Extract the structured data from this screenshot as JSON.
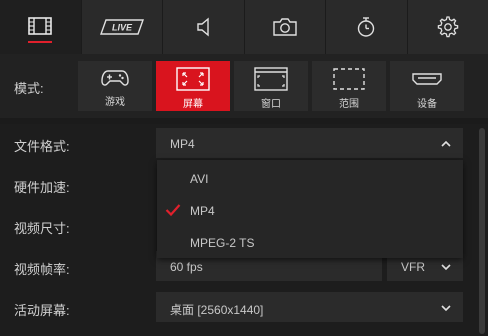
{
  "tabs": [
    {
      "icon": "film-icon",
      "active": true
    },
    {
      "icon": "live-icon",
      "text": "LIVE"
    },
    {
      "icon": "speaker-icon"
    },
    {
      "icon": "camera-icon"
    },
    {
      "icon": "stopwatch-icon"
    },
    {
      "icon": "gear-icon"
    }
  ],
  "mode": {
    "label": "模式:",
    "buttons": [
      {
        "label": "游戏",
        "icon": "gamepad-icon"
      },
      {
        "label": "屏幕",
        "icon": "fullscreen-icon",
        "active": true
      },
      {
        "label": "窗口",
        "icon": "window-icon"
      },
      {
        "label": "范围",
        "icon": "region-icon"
      },
      {
        "label": "设备",
        "icon": "hdmi-icon"
      }
    ]
  },
  "settings": {
    "file_format": {
      "label": "文件格式:",
      "value": "MP4"
    },
    "hw_accel": {
      "label": "硬件加速:"
    },
    "video_size": {
      "label": "视频尺寸:"
    },
    "frame_rate": {
      "label": "视频帧率:",
      "value": "60 fps",
      "mode_value": "VFR"
    },
    "active_screen": {
      "label": "活动屏幕:",
      "value": "桌面 [2560x1440]"
    }
  },
  "format_dropdown": {
    "options": [
      {
        "label": "AVI",
        "selected": false
      },
      {
        "label": "MP4",
        "selected": true
      },
      {
        "label": "MPEG-2 TS",
        "selected": false
      }
    ]
  },
  "colors": {
    "accent": "#d9141e",
    "background": "#1b1b1b",
    "tabbar": "#2a2a2a"
  }
}
